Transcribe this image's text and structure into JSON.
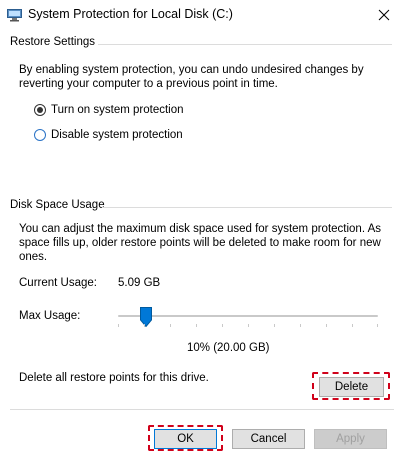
{
  "window": {
    "title": "System Protection for Local Disk (C:)",
    "title_icon": "system-properties-icon",
    "close_icon": "close-icon"
  },
  "restore_settings": {
    "heading": "Restore Settings",
    "description": "By enabling system protection, you can undo undesired changes by reverting your computer to a previous point in time.",
    "options": [
      {
        "label": "Turn on system protection",
        "selected": true
      },
      {
        "label": "Disable system protection",
        "selected": false
      }
    ]
  },
  "disk_space": {
    "heading": "Disk Space Usage",
    "description": "You can adjust the maximum disk space used for system protection. As space fills up, older restore points will be deleted to make room for new ones.",
    "current_usage_label": "Current Usage:",
    "current_usage_value": "5.09 GB",
    "max_usage_label": "Max Usage:",
    "max_usage_percent": 10,
    "max_usage_readout": "10% (20.00 GB)",
    "delete_text": "Delete all restore points for this drive.",
    "delete_label": "Delete"
  },
  "footer": {
    "ok_label": "OK",
    "cancel_label": "Cancel",
    "apply_label": "Apply"
  },
  "colors": {
    "highlight": "#d0021b",
    "accent": "#0078d7",
    "slider_thumb": "#0078d7"
  }
}
